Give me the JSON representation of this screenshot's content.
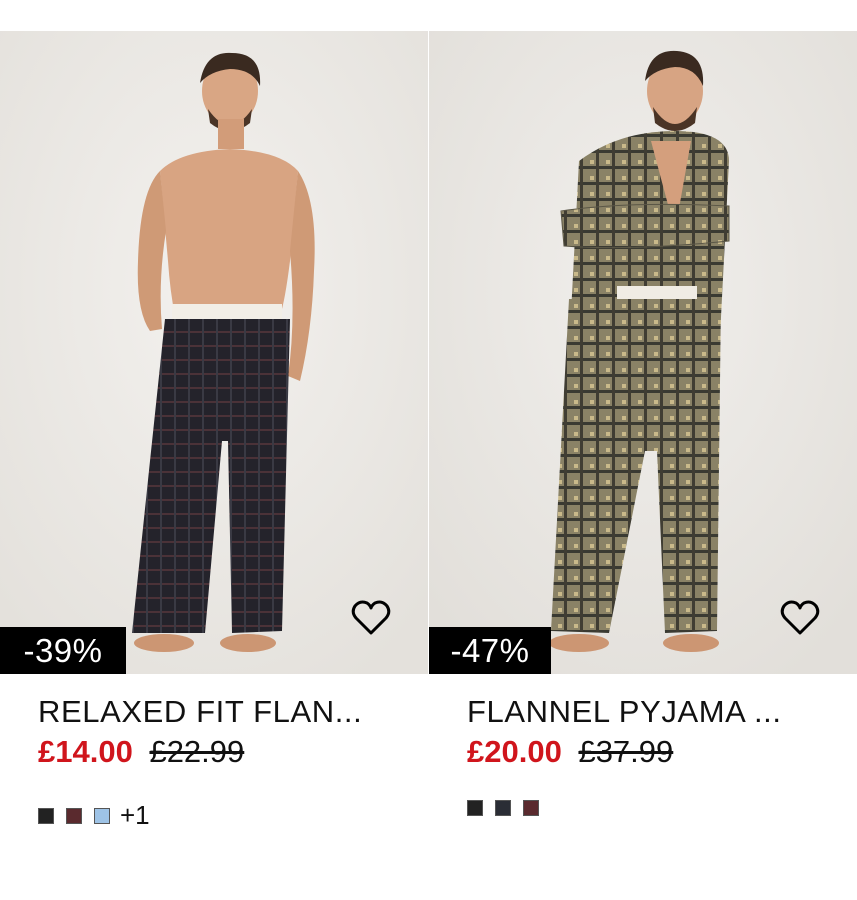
{
  "products": [
    {
      "discount": "-39%",
      "title": "RELAXED FIT FLAN...",
      "price_sale": "£14.00",
      "price_original": "£22.99",
      "swatches": [
        "#222222",
        "#5a2a2e",
        "#9ec3e6"
      ],
      "more_colours": "+1"
    },
    {
      "discount": "-47%",
      "title": "FLANNEL PYJAMA ...",
      "price_sale": "£20.00",
      "price_original": "£37.99",
      "swatches": [
        "#222222",
        "#2a2d35",
        "#5a2a2e"
      ]
    }
  ],
  "colors": {
    "sale_red": "#d0151c",
    "badge_bg": "#000000"
  }
}
